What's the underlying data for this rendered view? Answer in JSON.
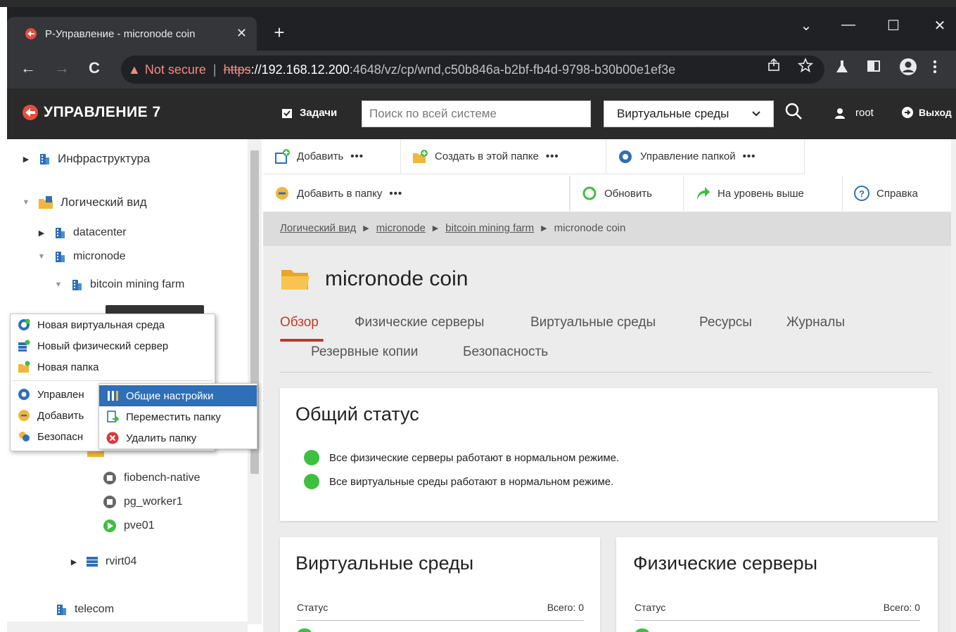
{
  "browser": {
    "tab_title": "Р-Управление - micronode coin",
    "close": "✕",
    "new_tab": "+",
    "win_down": "⌄",
    "win_min": "—",
    "win_max": "☐",
    "win_close": "✕",
    "back": "←",
    "forward": "→",
    "reload": "C",
    "not_secure": "Not secure",
    "separator": "|",
    "url_scheme": "https",
    "url_scheme_sep": "://",
    "url_host": "192.168.12.200",
    "url_path": ":4648/vz/cp/wnd,c50b846a-b2bf-fb4d-9798-b30b00e1ef3e"
  },
  "header": {
    "logo": "УПРАВЛЕНИЕ 7",
    "tasks": "Задачи",
    "search_placeholder": "Поиск по всей системе",
    "scope_select": "Виртуальные среды",
    "user": "root",
    "logout": "Выход"
  },
  "tree": {
    "infrastructure": "Инфраструктура",
    "logical_view": "Логический вид",
    "datacenter": "datacenter",
    "micronode": "micronode",
    "bitcoin_farm": "bitcoin mining farm",
    "fiobench": "fiobench-native",
    "pg_worker": "pg_worker1",
    "pve01": "pve01",
    "rvirt04": "rvirt04",
    "telecom": "telecom"
  },
  "context_menu": {
    "new_env": "Новая виртуальная среда",
    "new_server": "Новый физический сервер",
    "new_folder": "Новая папка",
    "manage": "Управлен",
    "add": "Добавить",
    "security": "Безопасн"
  },
  "submenu": {
    "general": "Общие настройки",
    "move": "Переместить папку",
    "delete": "Удалить папку"
  },
  "toolbar": {
    "add": "Добавить",
    "create_here": "Создать в этой папке",
    "manage_folder": "Управление папкой",
    "add_to_folder": "Добавить в папку",
    "refresh": "Обновить",
    "level_up": "На уровень выше",
    "help": "Справка",
    "more": "•••"
  },
  "breadcrumb": {
    "items": [
      "Логический вид",
      "micronode",
      "bitcoin mining farm"
    ],
    "current": "micronode coin",
    "separator": "▶"
  },
  "page": {
    "title": "micronode coin"
  },
  "tabs": {
    "overview": "Обзор",
    "physical": "Физические серверы",
    "virtual": "Виртуальные среды",
    "resources": "Ресурсы",
    "logs": "Журналы",
    "backups": "Резервные копии",
    "security": "Безопасность"
  },
  "status_card": {
    "title": "Общий статус",
    "line1": "Все физические серверы работают в нормальном режиме.",
    "line2": "Все виртуальные среды работают в нормальном режиме."
  },
  "ve_card": {
    "title": "Виртуальные среды",
    "status": "Статус",
    "total": "Всего: 0"
  },
  "ps_card": {
    "title": "Физические серверы",
    "status": "Статус",
    "total": "Всего: 0"
  },
  "colors": {
    "accent_red": "#c0392b",
    "ok_green": "#3fbf3f",
    "menu_highlight": "#2e6fb7",
    "header_dark": "#2a2a2a"
  }
}
